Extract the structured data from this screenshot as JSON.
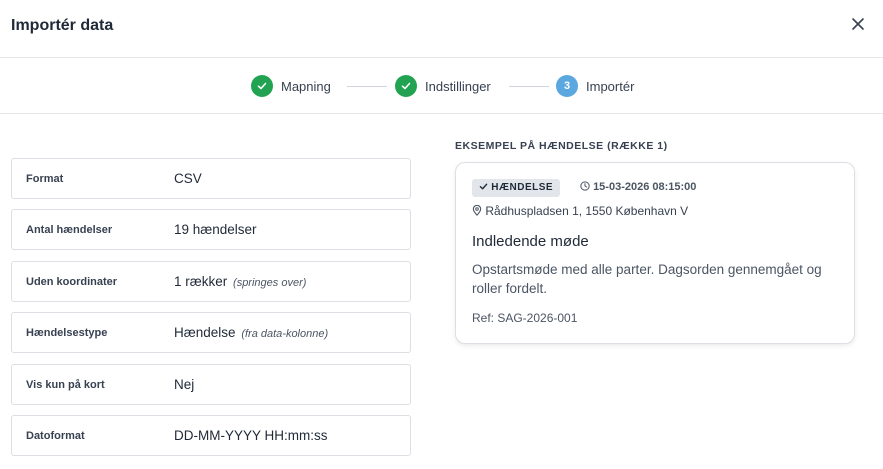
{
  "modal": {
    "title": "Importér data"
  },
  "stepper": {
    "steps": [
      {
        "label": "Mapning",
        "state": "done",
        "icon": "check-icon"
      },
      {
        "label": "Indstillinger",
        "state": "done",
        "icon": "check-icon"
      },
      {
        "label": "Importér",
        "state": "active",
        "number": "3"
      }
    ],
    "colors": {
      "done": "#22a352",
      "active": "#5ba8e0"
    }
  },
  "summary": [
    {
      "label": "Format",
      "value": "CSV",
      "note": ""
    },
    {
      "label": "Antal hændelser",
      "value": "19 hændelser",
      "note": ""
    },
    {
      "label": "Uden koordinater",
      "value": "1 rækker",
      "note": "(springes over)"
    },
    {
      "label": "Hændelsestype",
      "value": "Hændelse",
      "note": "(fra data-kolonne)"
    },
    {
      "label": "Vis kun på kort",
      "value": "Nej",
      "note": ""
    },
    {
      "label": "Datoformat",
      "value": "DD-MM-YYYY HH:mm:ss",
      "note": ""
    }
  ],
  "example": {
    "heading": "EKSEMPEL PÅ HÆNDELSE (RÆKKE 1)",
    "badge": "HÆNDELSE",
    "timestamp": "15-03-2026 08:15:00",
    "address": "Rådhuspladsen 1, 1550 København V",
    "title": "Indledende møde",
    "description": "Opstartsmøde med alle parter. Dagsorden gennemgået og roller fordelt.",
    "ref": "Ref: SAG-2026-001"
  }
}
